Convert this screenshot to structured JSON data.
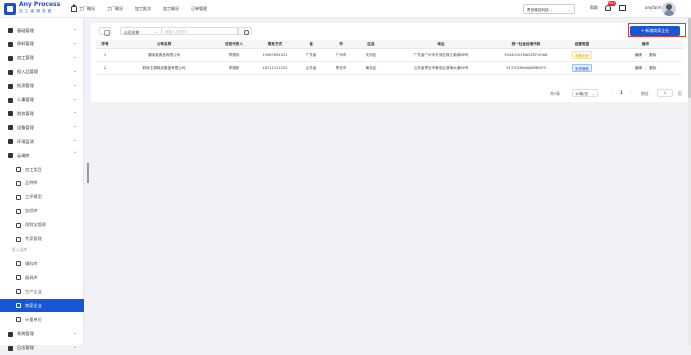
{
  "brand": {
    "name": "Any Process",
    "subtitle": "加 工 者 服 务 链"
  },
  "top_nav": [
    {
      "label": "工厂概况",
      "icon": "home-icon"
    },
    {
      "label": "工厂概况"
    },
    {
      "label": "加工批次"
    },
    {
      "label": "加工概况"
    },
    {
      "label": "订单管理"
    }
  ],
  "header": {
    "tenant": "青岛驿迈科技...",
    "help": "帮助",
    "notification_count": "99+",
    "username": "anyfarm"
  },
  "sidebar": {
    "items": [
      {
        "label": "基础管理",
        "icon": "base-icon",
        "chevron": "⌄"
      },
      {
        "label": "原料管理",
        "icon": "tools-icon",
        "chevron": "⌄"
      },
      {
        "label": "加工管理",
        "icon": "process-icon",
        "chevron": "⌄"
      },
      {
        "label": "投入品管理",
        "icon": "input-icon",
        "chevron": "⌄"
      },
      {
        "label": "检测管理",
        "icon": "detect-icon",
        "chevron": "⌄"
      },
      {
        "label": "人事管理",
        "icon": "person-icon",
        "chevron": "⌄"
      },
      {
        "label": "财务管理",
        "icon": "finance-icon",
        "chevron": "⌄"
      },
      {
        "label": "设备管理",
        "icon": "device-icon",
        "chevron": "⌄"
      },
      {
        "label": "环境监测",
        "icon": "env-icon",
        "chevron": "⌄"
      },
      {
        "label": "云端库",
        "icon": "cloud-icon",
        "chevron": "⌃"
      }
    ],
    "cloud_sub": [
      {
        "label": "加工类目",
        "icon": "category-icon"
      },
      {
        "label": "品种库",
        "icon": "variety-icon"
      },
      {
        "label": "工序模型",
        "icon": "model-icon"
      },
      {
        "label": "加经库",
        "icon": "library-icon"
      },
      {
        "label": "保鲜宝管理",
        "icon": "clock-icon"
      },
      {
        "label": "专家管理",
        "icon": "expert-icon"
      }
    ],
    "input_group_label": "投入品库",
    "input_sub": [
      {
        "label": "辅料库",
        "icon": "circle-icon"
      },
      {
        "label": "器具库",
        "icon": "tool-icon"
      },
      {
        "label": "生产企业",
        "icon": "factory-icon"
      },
      {
        "label": "商家企业",
        "icon": "merchant-icon",
        "active": true
      },
      {
        "label": "计量单位",
        "icon": "unit-icon"
      }
    ],
    "bottom_items": [
      {
        "label": "系统管理",
        "icon": "system-icon",
        "chevron": "⌄"
      },
      {
        "label": "日志管理",
        "icon": "log-icon",
        "chevron": "⌄"
      }
    ]
  },
  "search": {
    "field": "公司名称",
    "placeholder": "请输入关键词"
  },
  "add_button": "+ 新增商家企业",
  "table": {
    "headers": [
      "序号",
      "公司名称",
      "法定代表人",
      "联系方式",
      "省",
      "市",
      "区县",
      "地址",
      "统一社会信用代码",
      "经营类型",
      "操作"
    ],
    "rows": [
      [
        "1",
        "湛味香食品有限公司",
        "李德伟",
        "15987854321",
        "广东省",
        "广州市",
        "天河区",
        "广东省广州市天河区珠江新城88号",
        "91440101MA5ZEFGHA6",
        "商家企业",
        ""
      ],
      [
        "2",
        "鲜味王调味品集团有限公司",
        "李德新",
        "18711112222",
        "山东省",
        "青岛市",
        "黄岛区",
        "山东省青岛市黄岛区滨海大道66号",
        "913702MA6ABMNOP3",
        "批零兼营",
        ""
      ]
    ],
    "row_tags": [
      "warn",
      "info"
    ],
    "actions": [
      "编辑",
      "|",
      "删除"
    ]
  },
  "pagination": {
    "total": "共2条",
    "page_size": "10条/页",
    "current": "1",
    "goto_label": "前往",
    "goto_value": "1",
    "unit": "页"
  }
}
